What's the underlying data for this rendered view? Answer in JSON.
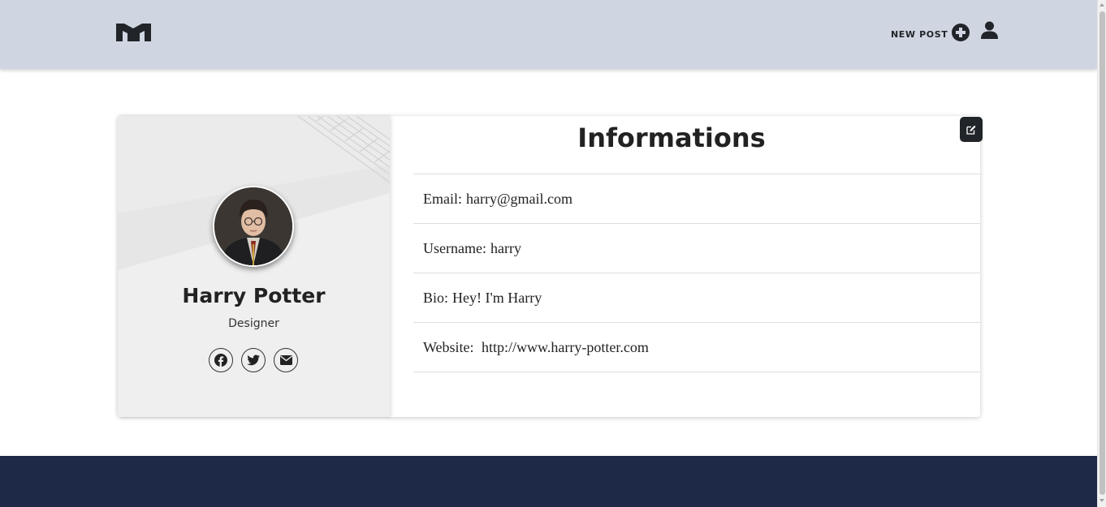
{
  "navbar": {
    "logo_icon": "m-logo-icon",
    "new_post_label": "NEW POST",
    "new_post_icon": "plus-circle-icon",
    "user_icon": "user-icon"
  },
  "profile": {
    "name": "Harry Potter",
    "role": "Designer",
    "avatar_icon": "avatar-photo",
    "socials": [
      {
        "icon": "facebook-icon"
      },
      {
        "icon": "twitter-icon"
      },
      {
        "icon": "envelope-icon"
      }
    ]
  },
  "info": {
    "title": "Informations",
    "edit_icon": "edit-icon",
    "rows": [
      {
        "label": "Email:",
        "value": "harry@gmail.com"
      },
      {
        "label": "Username:",
        "value": "harry"
      },
      {
        "label": "Bio:",
        "value": "Hey! I'm Harry"
      },
      {
        "label": "Website:",
        "value": " http://www.harry-potter.com"
      }
    ]
  },
  "colors": {
    "navbar_bg": "#d0d6e1",
    "footer_bg": "#1d2947",
    "profile_bg": "#efefef",
    "accent_dark": "#212529"
  }
}
